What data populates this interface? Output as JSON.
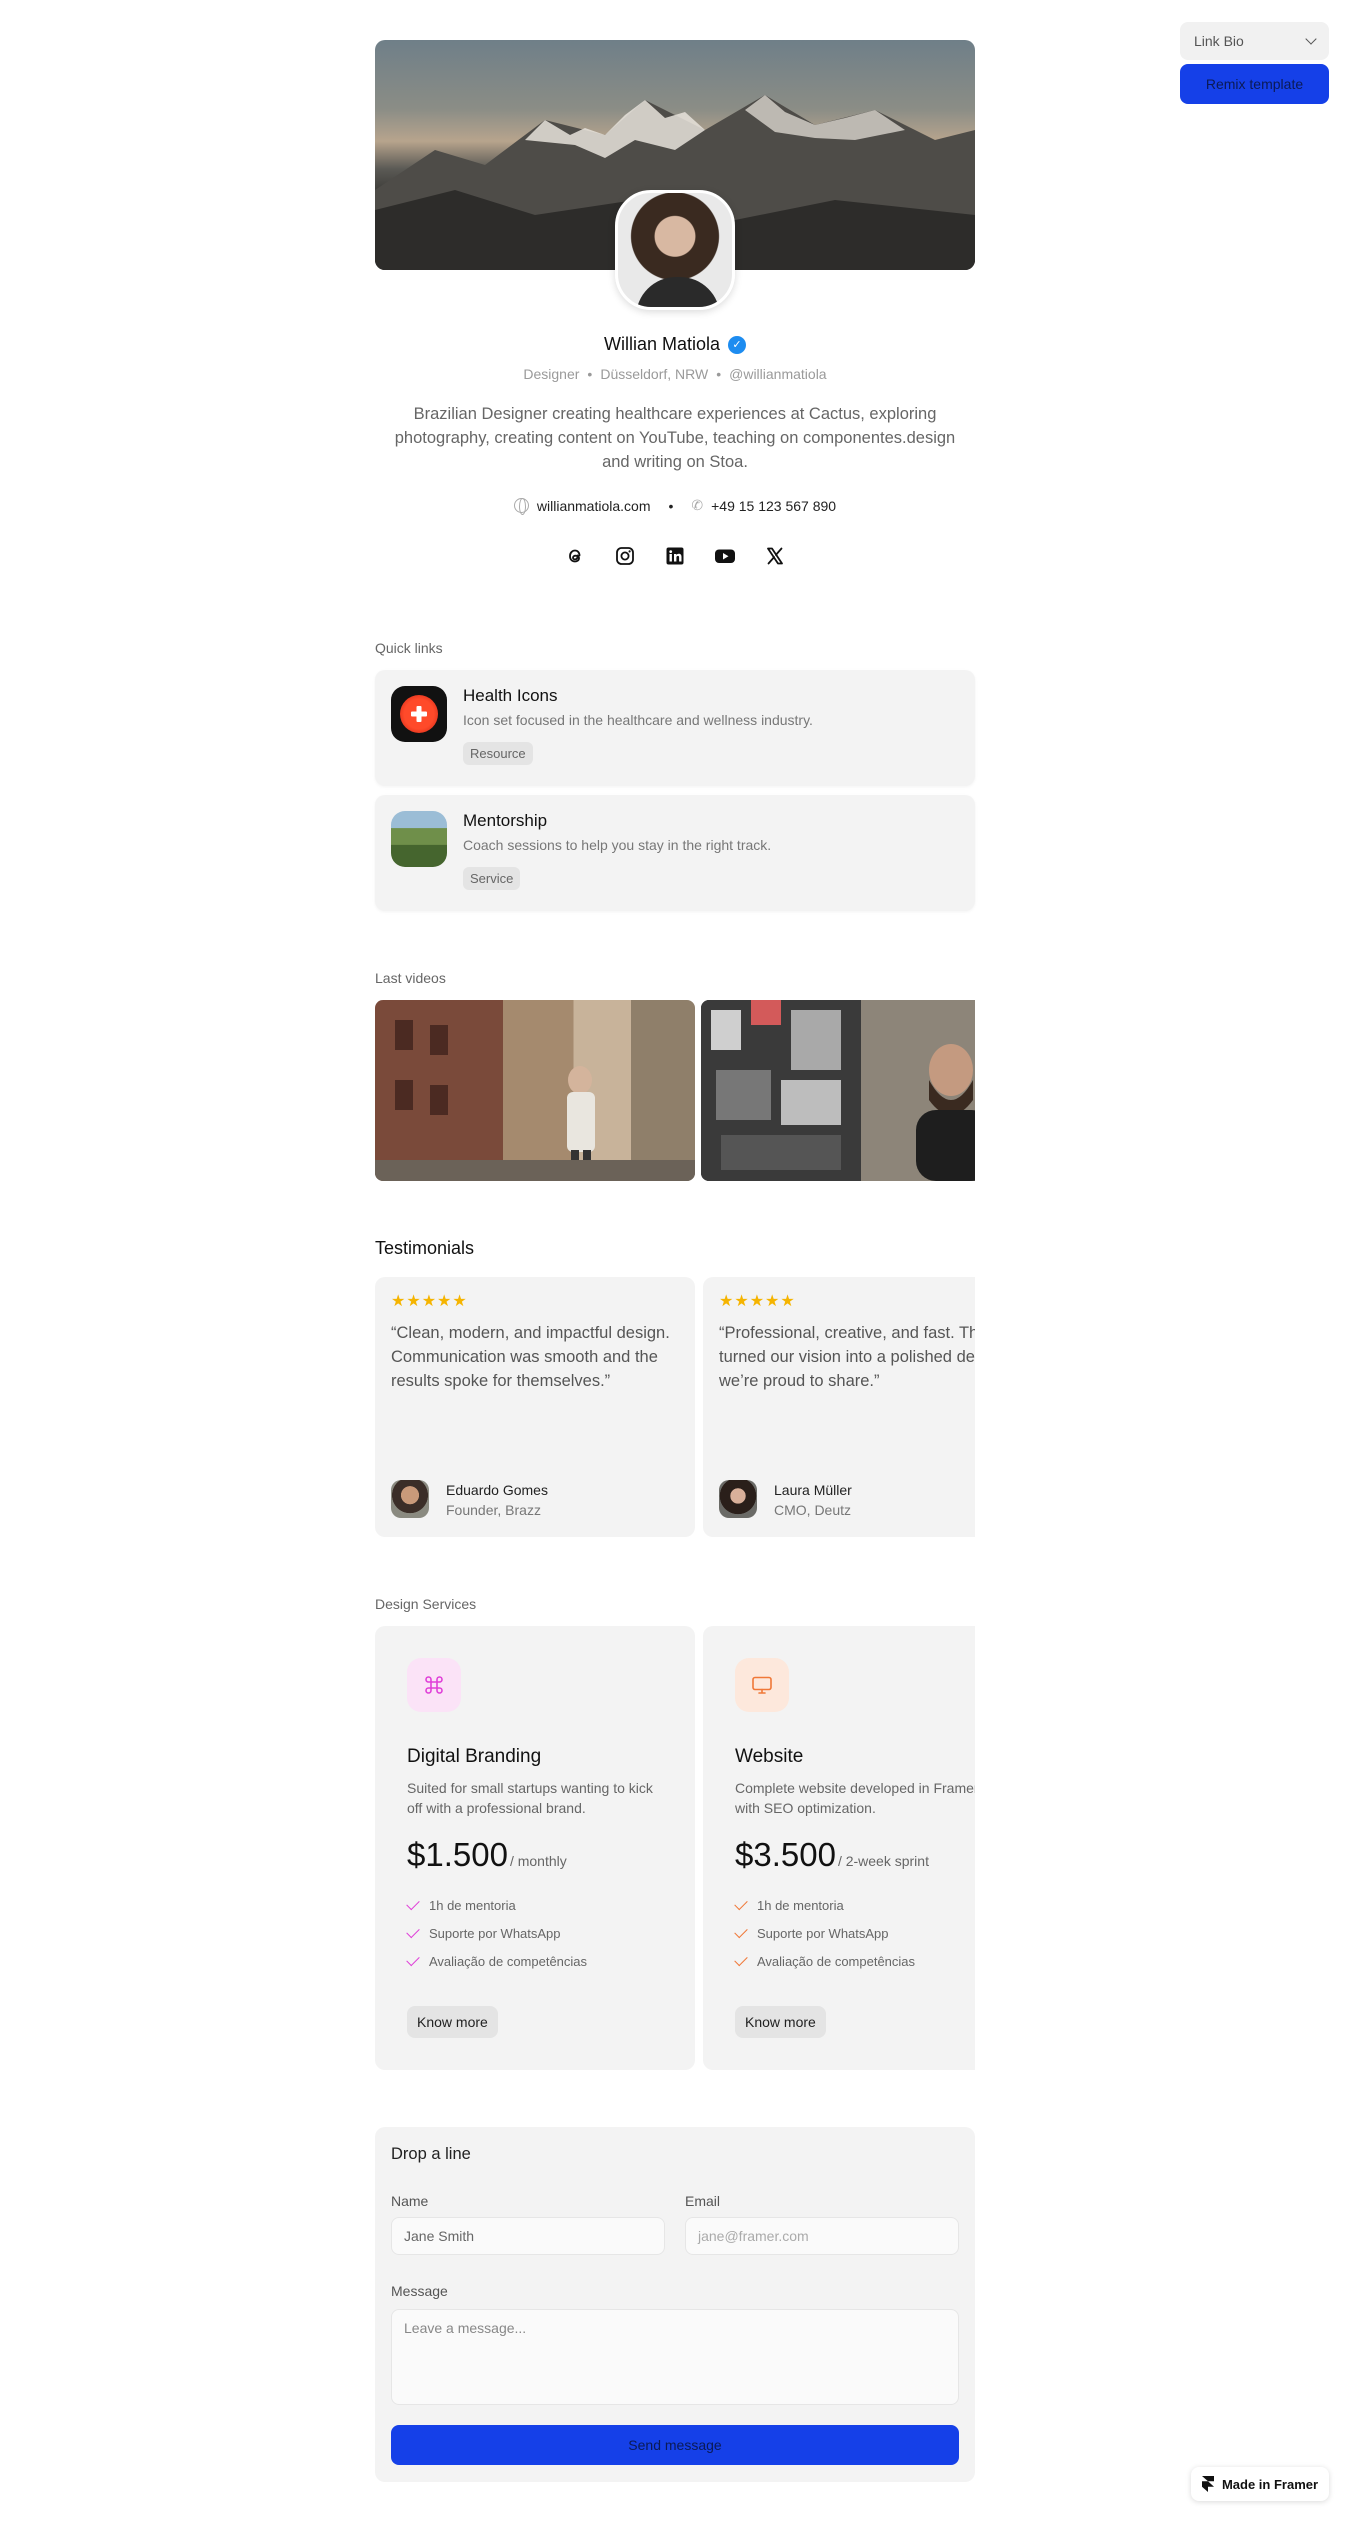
{
  "top_controls": {
    "select_value": "Link Bio",
    "remix_label": "Remix template"
  },
  "profile": {
    "name": "Willian Matiola",
    "role": "Designer",
    "location": "Düsseldorf, NRW",
    "handle": "@willianmatiola",
    "bio": "Brazilian Designer creating healthcare experiences at Cactus, exploring photography, creating content on YouTube, teaching on componentes.design and writing on Stoa.",
    "website": "willianmatiola.com",
    "phone": "+49 15 123 567 890",
    "socials": [
      "threads-icon",
      "instagram-icon",
      "linkedin-icon",
      "youtube-icon",
      "x-icon"
    ]
  },
  "quick_links": {
    "label": "Quick links",
    "items": [
      {
        "title": "Health Icons",
        "desc": "Icon set focused in the healthcare and wellness industry.",
        "tag": "Resource"
      },
      {
        "title": "Mentorship",
        "desc": "Coach sessions to help you stay in the right track.",
        "tag": "Service"
      }
    ]
  },
  "videos": {
    "label": "Last videos"
  },
  "testimonials": {
    "title": "Testimonials",
    "items": [
      {
        "stars": "★★★★★",
        "quote": "“Clean, modern, and impactful design. Communication was smooth and the results spoke for themselves.”",
        "name": "Eduardo Gomes",
        "role": "Founder, Brazz"
      },
      {
        "stars": "★★★★★",
        "quote": "“Professional, creative, and fast. They turned our vision into a polished design we’re proud to share.”",
        "name": "Laura Müller",
        "role": "CMO, Deutz"
      }
    ]
  },
  "services": {
    "label": "Design Services",
    "items": [
      {
        "title": "Digital Branding",
        "desc": "Suited for small startups wanting to kick off with a professional brand.",
        "price": "$1.500",
        "period": "/ monthly",
        "features": [
          "1h de mentoria",
          "Suporte por WhatsApp",
          "Avaliação de competências"
        ],
        "button": "Know more",
        "accent": "#e040d8"
      },
      {
        "title": "Website",
        "desc": "Complete website developed in Framer with SEO optimization.",
        "price": "$3.500",
        "period": "/ 2-week sprint",
        "features": [
          "1h de mentoria",
          "Suporte por WhatsApp",
          "Avaliação de competências"
        ],
        "button": "Know more",
        "accent": "#f07838"
      }
    ]
  },
  "contact_form": {
    "title": "Drop a line",
    "name_label": "Name",
    "name_value": "Jane Smith",
    "email_label": "Email",
    "email_placeholder": "jane@framer.com",
    "message_label": "Message",
    "message_placeholder": "Leave a message...",
    "submit": "Send message"
  },
  "badge": {
    "label": "Made in Framer"
  },
  "colors": {
    "primary": "#1540e8",
    "star": "#f5b400",
    "verified": "#1d8cf0"
  }
}
